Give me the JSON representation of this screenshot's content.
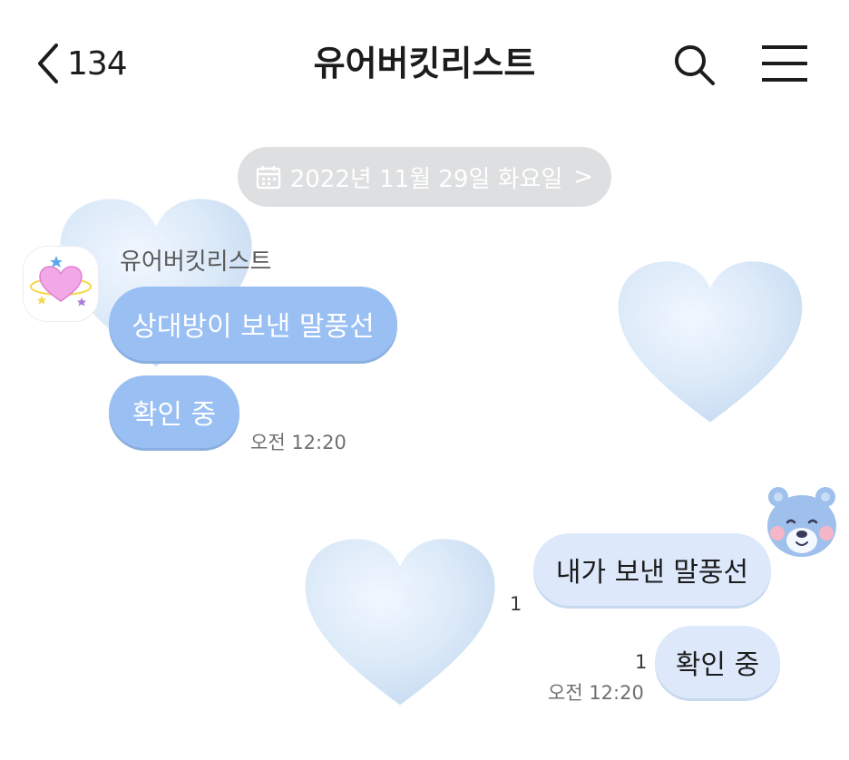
{
  "header": {
    "back_icon": "chevron-left-icon",
    "unread_count": "134",
    "title": "유어버킷리스트",
    "search_icon": "search-icon",
    "menu_icon": "menu-icon"
  },
  "date_divider": {
    "icon": "calendar-icon",
    "label": "2022년 11월 29일 화요일",
    "chevron": ">"
  },
  "incoming": {
    "sender_name": "유어버킷리스트",
    "messages": [
      {
        "text": "상대방이 보낸 말풍선"
      },
      {
        "text": "확인 중"
      }
    ],
    "time": "오전 12:20"
  },
  "outgoing": {
    "messages": [
      {
        "text": "내가 보낸 말풍선",
        "unread": "1"
      },
      {
        "text": "확인 중",
        "unread": "1"
      }
    ],
    "time": "오전 12:20"
  },
  "colors": {
    "incoming_bubble": "#99bff3",
    "outgoing_bubble": "#dde9fb",
    "date_pill": "#dedfe0",
    "heart": "#dbe9f8"
  }
}
